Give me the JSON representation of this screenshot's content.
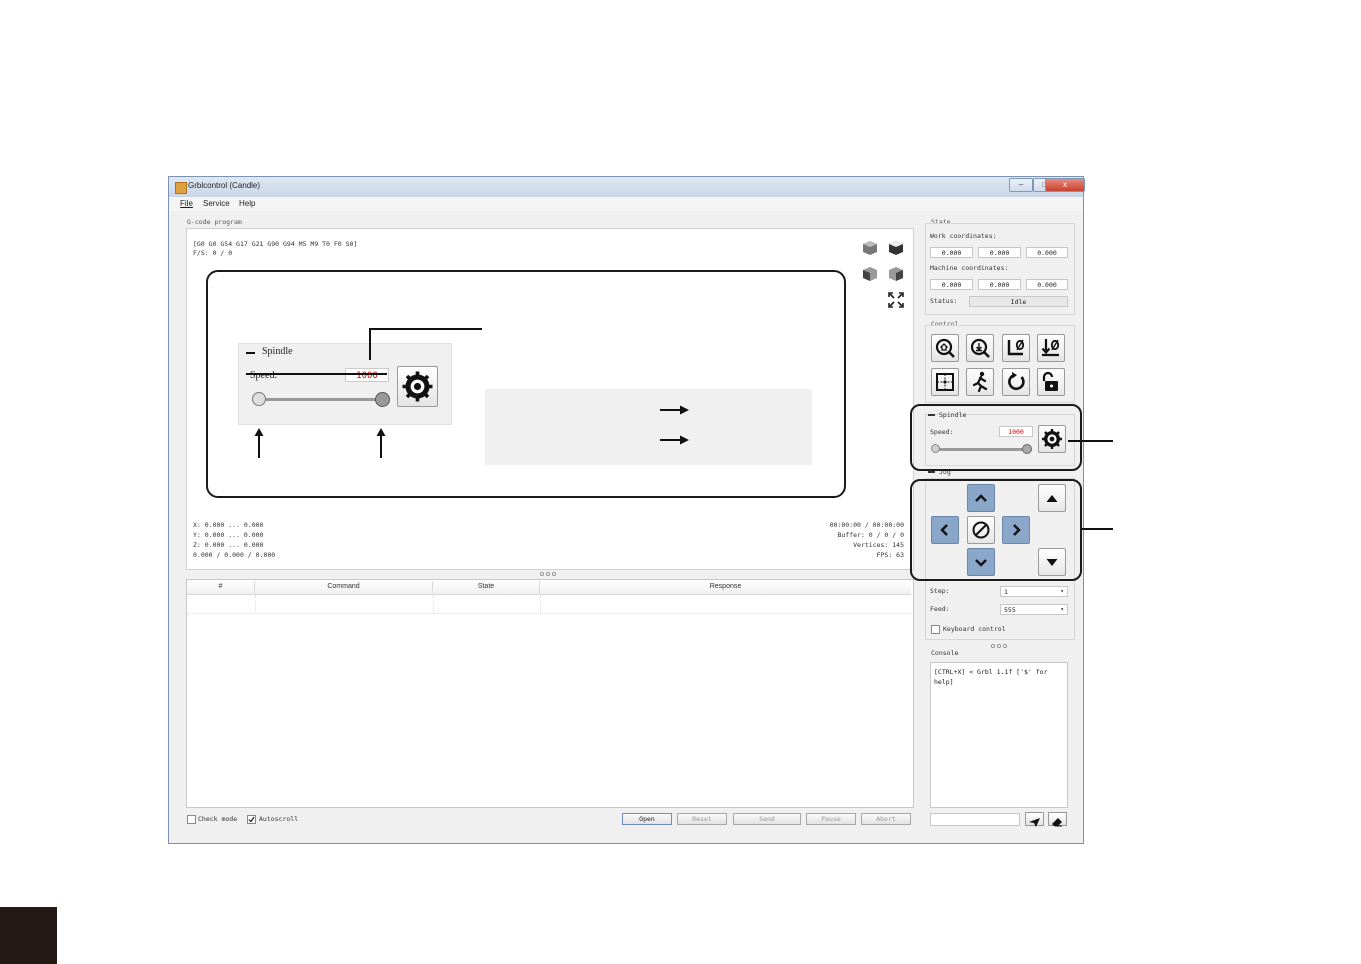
{
  "window": {
    "title": "Grblcontrol (Candle)",
    "controls": [
      "–",
      "□",
      "x"
    ]
  },
  "menu": [
    "File",
    "Service",
    "Help"
  ],
  "program": {
    "label": "G-code program",
    "gcode_state": "[G0 G0 G54 G17 G21 G90 G94 M5 M9 T0 F0 S0]",
    "fs": "F/S: 0 / 0",
    "coords": [
      "X: 0.000 ... 0.000",
      "Y: 0.000 ... 0.000",
      "Z: 0.000 ... 0.000",
      "0.000 / 0.000 / 0.000"
    ],
    "stats": [
      "00:00:00 / 00:00:00",
      "Buffer: 0 / 0 / 0",
      "Vertices: 145",
      "FPS: 63"
    ]
  },
  "table": {
    "columns": [
      "#",
      "Command",
      "State",
      "Response"
    ]
  },
  "bottom": {
    "check_mode": "Check mode",
    "autoscroll": "Autoscroll",
    "buttons": [
      "Open",
      "Reset",
      "Send",
      "Pause",
      "Abort"
    ]
  },
  "state": {
    "label": "State",
    "work_label": "Work coordinates:",
    "work": [
      "0.000",
      "0.000",
      "0.000"
    ],
    "machine_label": "Machine coordinates:",
    "machine": [
      "0.000",
      "0.000",
      "0.000"
    ],
    "status_label": "Status:",
    "status": "Idle"
  },
  "control": {
    "label": "Control"
  },
  "spindle": {
    "label": "Spindle",
    "speed_label": "Speed:",
    "speed": "1000",
    "slider_level": 1.0
  },
  "jog": {
    "label": "Jog",
    "step_label": "Step:",
    "step": "1",
    "feed_label": "Feed:",
    "feed": "555",
    "keyboard": "Keyboard control"
  },
  "console": {
    "label": "Console",
    "text": "[CTRL+X] < Grbl 1.1f ['$' for help]"
  },
  "zoom": {
    "label": "Spindle",
    "speed_label": "Speed:",
    "speed": "1000"
  },
  "colors": {
    "accent_blue": "#8aa6c8",
    "speed_red": "#cc0000",
    "annotation": "#1a1a1a"
  }
}
